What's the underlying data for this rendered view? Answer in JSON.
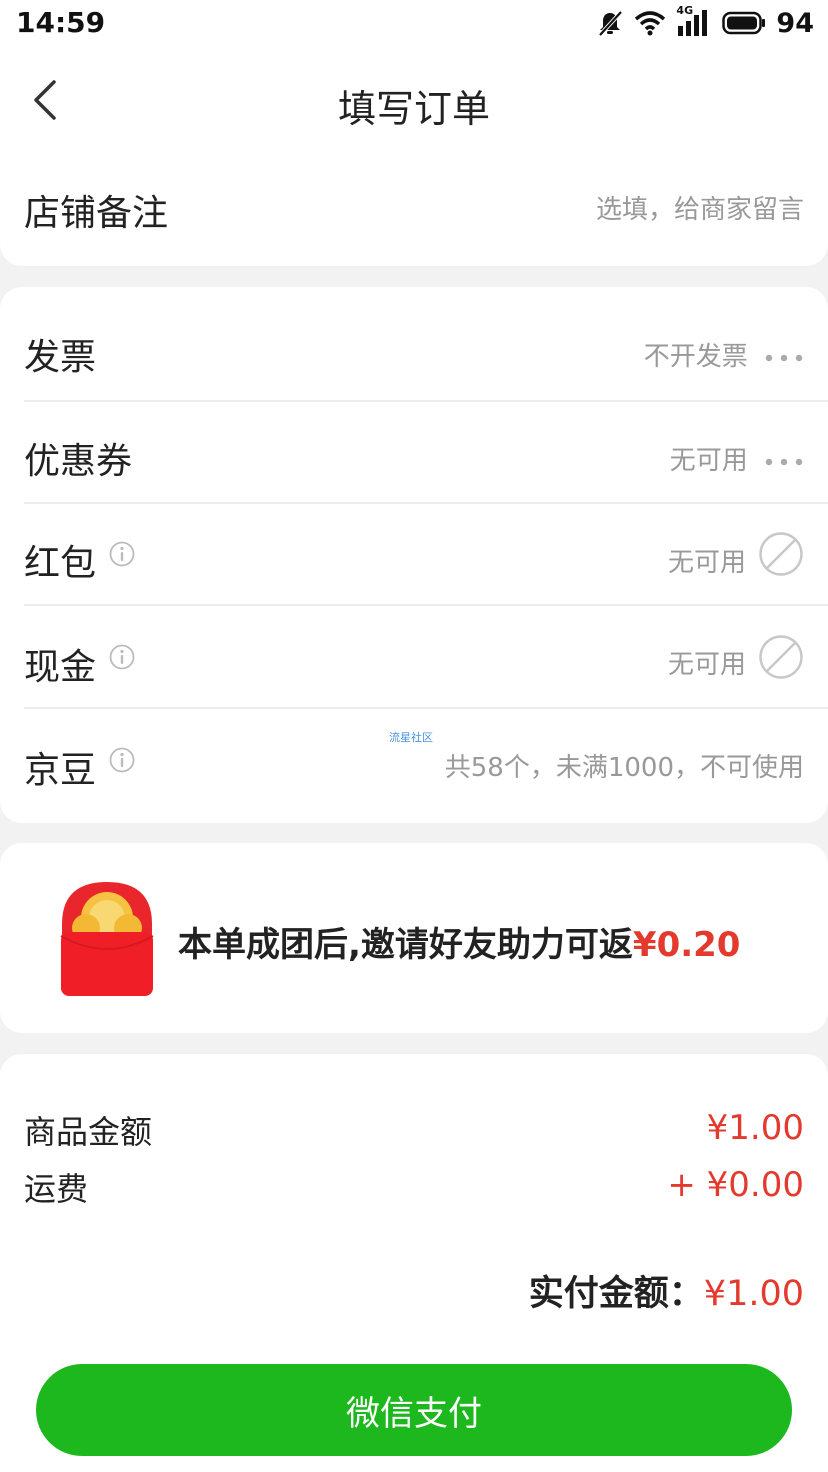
{
  "status_bar": {
    "time": "14:59",
    "network": "4G",
    "battery": "94",
    "icons": [
      "mute-icon",
      "wifi-icon",
      "signal-icon",
      "battery-icon"
    ]
  },
  "header": {
    "title": "填写订单",
    "back_icon": "back-arrow-icon"
  },
  "store_remark": {
    "label": "店铺备注",
    "placeholder": "选填，给商家留言"
  },
  "options": {
    "invoice": {
      "label": "发票",
      "value": "不开发票"
    },
    "coupon": {
      "label": "优惠券",
      "value": "无可用"
    },
    "red_packet": {
      "label": "红包",
      "value": "无可用"
    },
    "cash": {
      "label": "现金",
      "value": "无可用"
    },
    "jingdou": {
      "label": "京豆",
      "value": "共58个，未满1000，不可使用"
    }
  },
  "watermark": "流星社区",
  "promo": {
    "text": "本单成团后,邀请好友助力可返",
    "amount": "¥0.20",
    "icon": "red-packet-icon"
  },
  "summary": {
    "goods_label": "商品金额",
    "goods_value": "¥1.00",
    "shipping_label": "运费",
    "shipping_value": "+ ¥0.00",
    "total_label": "实付金额：",
    "total_value": "¥1.00"
  },
  "pay_button": "微信支付",
  "colors": {
    "accent_green": "#1db81d",
    "price_red": "#e33a2d",
    "muted_text": "#999999",
    "background": "#f2f2f2"
  }
}
